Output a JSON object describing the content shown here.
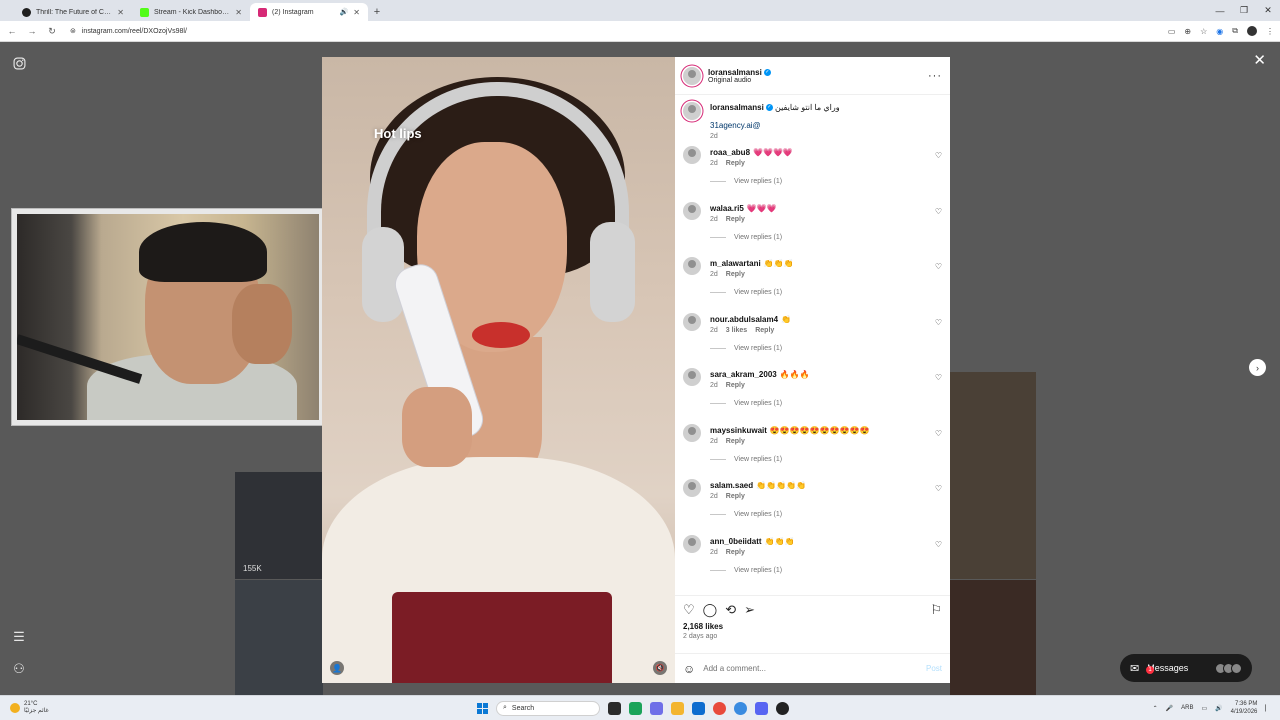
{
  "browser": {
    "tabs": [
      {
        "title": "Thrill: The Future of Crypto Casino",
        "active": false,
        "favicon_color": "#1f1f1f"
      },
      {
        "title": "Stream - Kick Dashboard",
        "active": false,
        "favicon_color": "#53fc18"
      },
      {
        "title": "(2) Instagram",
        "active": true,
        "favicon_color": "#d62976",
        "audio": true
      }
    ],
    "url": "instagram.com/reel/DXOzojVs98l/",
    "icons": [
      "back-icon",
      "forward-icon",
      "reload-icon",
      "site-info-icon",
      "cast-icon",
      "zoom-icon",
      "bookmark-star-icon",
      "extensions-icon",
      "profile-icon",
      "menu-icon"
    ]
  },
  "page": {
    "thumbs": [
      {
        "views": "155K"
      }
    ]
  },
  "post": {
    "overlay_text": "Hot lips",
    "author": "loransalmansi",
    "audio": "Original audio",
    "caption_user": "loransalmansi",
    "caption_text": "وراي ما انتو شايفين",
    "caption_link": "31agency.ai@",
    "caption_time": "2d",
    "likes": "2,168 likes",
    "ago": "2 days ago",
    "add_comment_placeholder": "Add a comment...",
    "post_label": "Post"
  },
  "comments": [
    {
      "user": "roaa_abu8",
      "text": "💗💗💗💗",
      "time": "2d",
      "likes": "",
      "reply": "Reply",
      "view": "View replies (1)"
    },
    {
      "user": "walaa.ri5",
      "text": "💗💗💗",
      "time": "2d",
      "likes": "",
      "reply": "Reply",
      "view": "View replies (1)"
    },
    {
      "user": "m_alawartani",
      "text": "👏👏👏",
      "time": "2d",
      "likes": "",
      "reply": "Reply",
      "view": "View replies (1)"
    },
    {
      "user": "nour.abdulsalam4",
      "text": "👏",
      "time": "2d",
      "likes": "3 likes",
      "reply": "Reply",
      "view": "View replies (1)"
    },
    {
      "user": "sara_akram_2003",
      "text": "🔥🔥🔥",
      "time": "2d",
      "likes": "",
      "reply": "Reply",
      "view": "View replies (1)"
    },
    {
      "user": "mayssinkuwait",
      "text": "😍😍😍😍😍😍😍😍😍😍",
      "time": "2d",
      "likes": "",
      "reply": "Reply",
      "view": "View replies (1)"
    },
    {
      "user": "salam.saed",
      "text": "👏👏👏👏👏",
      "time": "2d",
      "likes": "",
      "reply": "Reply",
      "view": "View replies (1)"
    },
    {
      "user": "ann_0beiidatt",
      "text": "👏👏👏",
      "time": "2d",
      "likes": "",
      "reply": "Reply",
      "view": "View replies (1)"
    }
  ],
  "messages": {
    "label": "Messages",
    "badge": "1"
  },
  "taskbar": {
    "weather_temp": "21°C",
    "weather_desc": "غائم جزئيًا",
    "search_placeholder": "Search",
    "lang": "ARB",
    "time": "7:36 PM",
    "date": "4/19/2026"
  },
  "colors": {
    "accent": "#0095f6",
    "brand_ring": "#d62976",
    "backdrop": "#595959"
  }
}
